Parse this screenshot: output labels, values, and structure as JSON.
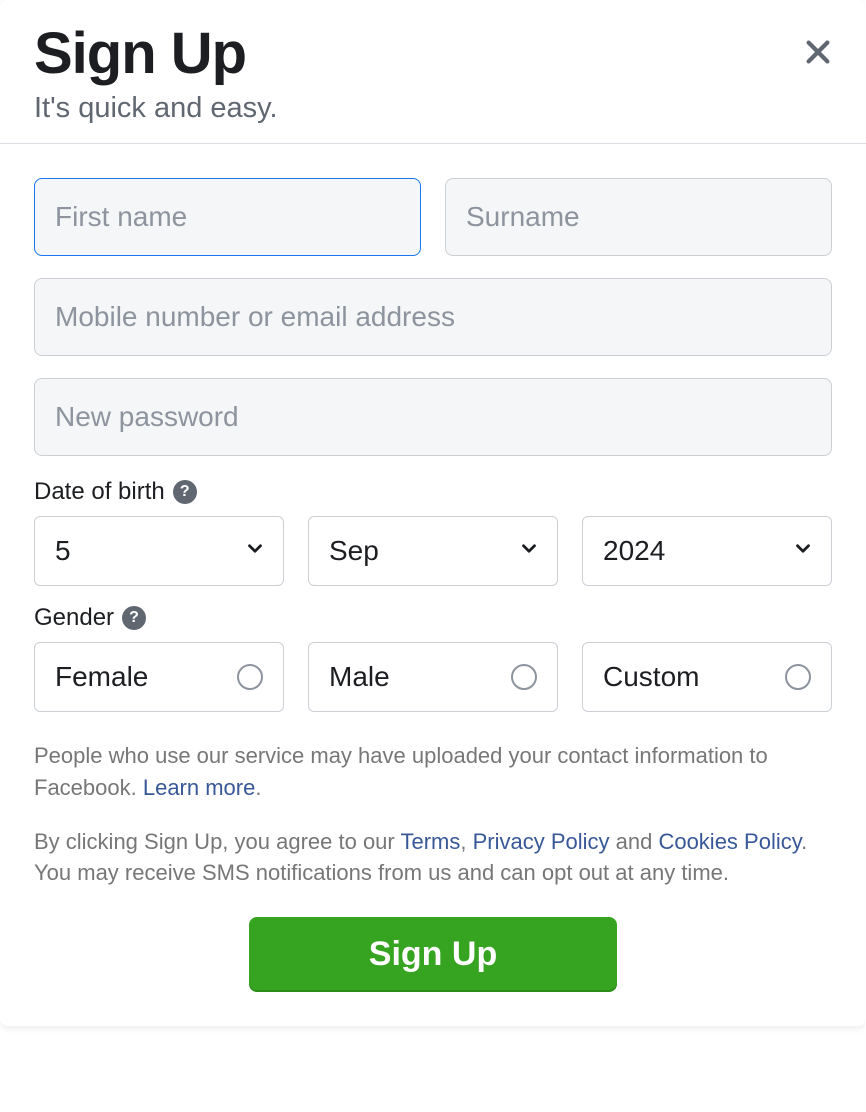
{
  "header": {
    "title": "Sign Up",
    "subtitle": "It's quick and easy."
  },
  "form": {
    "first_name_placeholder": "First name",
    "surname_placeholder": "Surname",
    "contact_placeholder": "Mobile number or email address",
    "password_placeholder": "New password",
    "dob_label": "Date of birth",
    "dob": {
      "day": "5",
      "month": "Sep",
      "year": "2024"
    },
    "gender_label": "Gender",
    "gender_options": {
      "female": "Female",
      "male": "Male",
      "custom": "Custom"
    }
  },
  "disclaimer": {
    "p1_a": "People who use our service may have uploaded your contact information to Facebook. ",
    "learn_more": "Learn more",
    "period1": ".",
    "p2_a": "By clicking Sign Up, you agree to our ",
    "terms": "Terms",
    "comma": ", ",
    "privacy": "Privacy Policy",
    "and": " and ",
    "cookies": "Cookies Policy",
    "p2_b": ". You may receive SMS notifications from us and can opt out at any time."
  },
  "submit_label": "Sign Up"
}
